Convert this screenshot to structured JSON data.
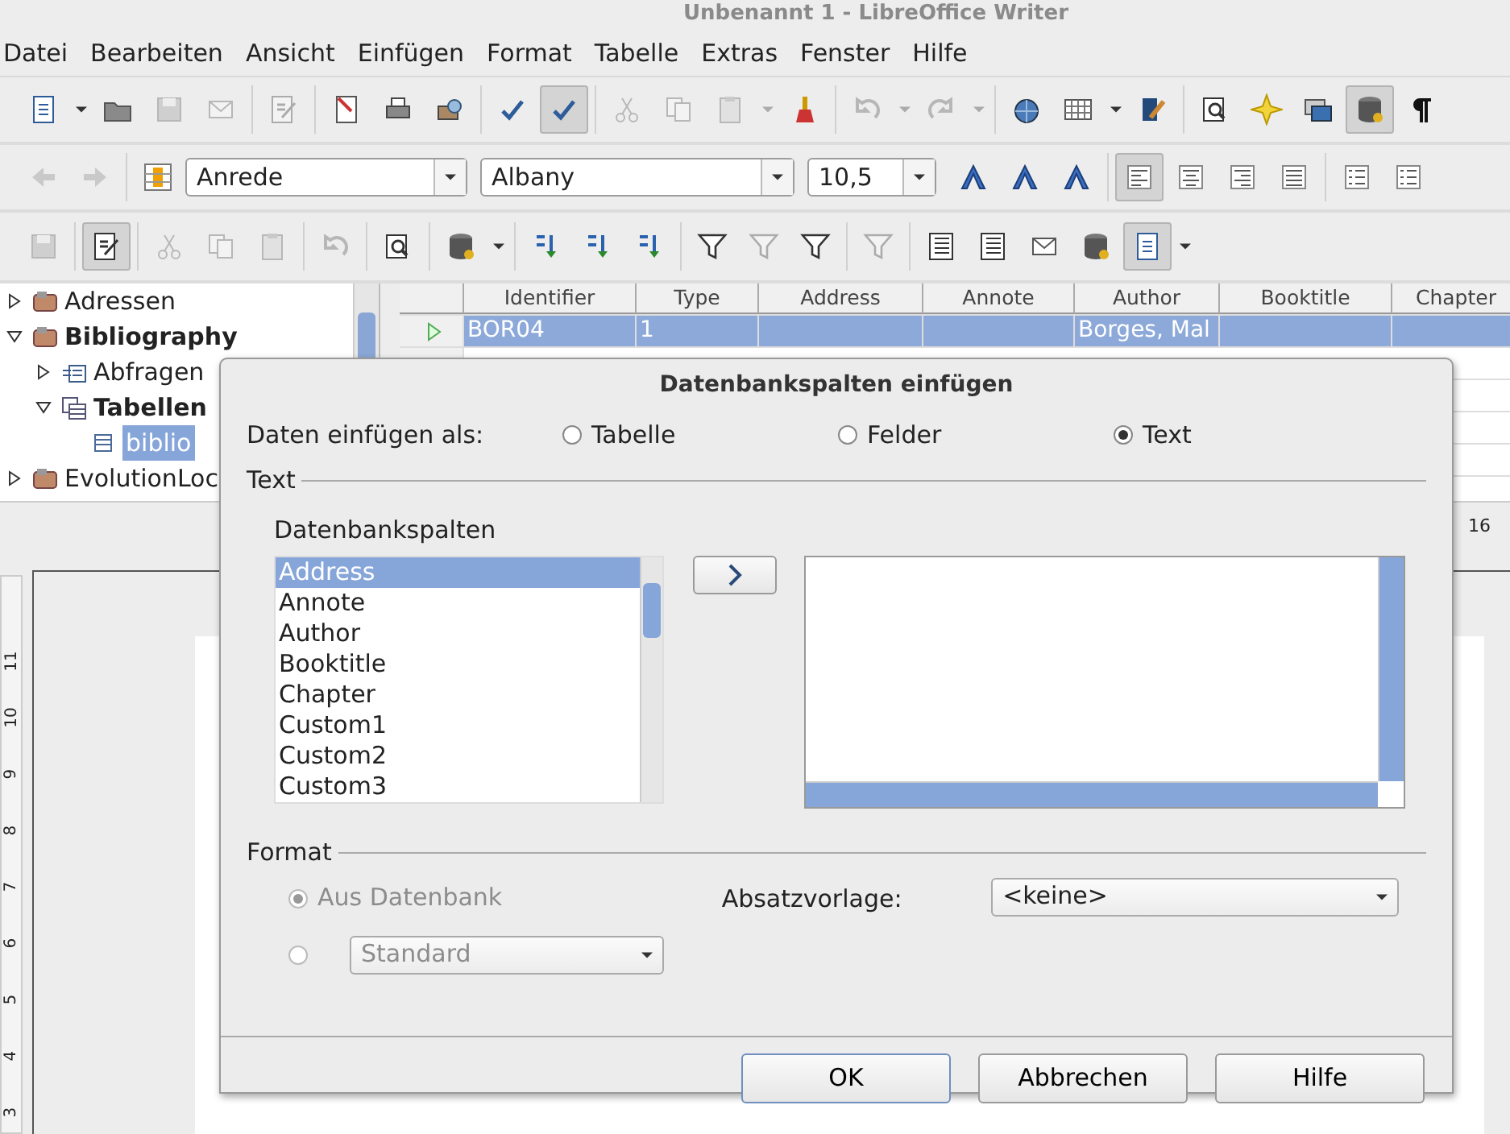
{
  "window": {
    "title": "Unbenannt 1 - LibreOffice Writer"
  },
  "menu": [
    "Datei",
    "Bearbeiten",
    "Ansicht",
    "Einfügen",
    "Format",
    "Tabelle",
    "Extras",
    "Fenster",
    "Hilfe"
  ],
  "toolbars": [
    [
      [
        {
          "kind": "document",
          "disabled": false,
          "pressed": false
        },
        {
          "kind": "caret",
          "disabled": false,
          "pressed": false
        },
        {
          "kind": "folder",
          "disabled": false,
          "pressed": false
        },
        {
          "kind": "floppy",
          "disabled": true,
          "pressed": false
        },
        {
          "kind": "envelope",
          "disabled": true,
          "pressed": false
        }
      ],
      [
        {
          "kind": "edit-document",
          "disabled": true,
          "pressed": false
        }
      ],
      [
        {
          "kind": "pdf-document",
          "disabled": false,
          "pressed": false
        },
        {
          "kind": "printer",
          "disabled": false,
          "pressed": false
        },
        {
          "kind": "print-preview",
          "disabled": false,
          "pressed": false
        }
      ],
      [
        {
          "kind": "check-mark",
          "disabled": false,
          "pressed": false
        },
        {
          "kind": "check-mark",
          "disabled": false,
          "pressed": true
        }
      ],
      [
        {
          "kind": "scissors",
          "disabled": true,
          "pressed": false
        },
        {
          "kind": "copy",
          "disabled": true,
          "pressed": false
        },
        {
          "kind": "clipboard",
          "disabled": true,
          "pressed": false
        },
        {
          "kind": "caret",
          "disabled": true,
          "pressed": false
        },
        {
          "kind": "paintbrush",
          "disabled": false,
          "pressed": false
        }
      ],
      [
        {
          "kind": "undo",
          "disabled": true,
          "pressed": false
        },
        {
          "kind": "caret",
          "disabled": true,
          "pressed": false
        },
        {
          "kind": "redo",
          "disabled": true,
          "pressed": false
        },
        {
          "kind": "caret",
          "disabled": true,
          "pressed": false
        }
      ],
      [
        {
          "kind": "globe",
          "disabled": false,
          "pressed": false
        },
        {
          "kind": "table",
          "disabled": false,
          "pressed": false
        },
        {
          "kind": "caret",
          "disabled": false,
          "pressed": false
        },
        {
          "kind": "pencil",
          "disabled": false,
          "pressed": false
        }
      ],
      [
        {
          "kind": "magnifier",
          "disabled": false,
          "pressed": false
        },
        {
          "kind": "star",
          "disabled": false,
          "pressed": false
        },
        {
          "kind": "monitor",
          "disabled": false,
          "pressed": false
        },
        {
          "kind": "database",
          "disabled": false,
          "pressed": true
        },
        {
          "kind": "pilcrow",
          "disabled": false,
          "pressed": false
        }
      ]
    ],
    [
      [
        {
          "kind": "arrow-left",
          "disabled": true,
          "pressed": false
        },
        {
          "kind": "arrow-right",
          "disabled": true,
          "pressed": false
        }
      ],
      [
        {
          "kind": "styles",
          "disabled": false,
          "pressed": false
        },
        {
          "kind": "combo",
          "value": "Anrede",
          "disabled": false
        },
        {
          "kind": "combo",
          "value": "Albany",
          "disabled": false
        },
        {
          "kind": "combo",
          "value": "10,5",
          "disabled": false
        },
        {
          "kind": "text-style",
          "disabled": false,
          "pressed": false
        },
        {
          "kind": "text-style",
          "disabled": false,
          "pressed": false
        },
        {
          "kind": "text-style",
          "disabled": false,
          "pressed": false
        }
      ],
      [
        {
          "kind": "align-left",
          "disabled": false,
          "pressed": true
        },
        {
          "kind": "align-center",
          "disabled": false,
          "pressed": false
        },
        {
          "kind": "align-right",
          "disabled": false,
          "pressed": false
        },
        {
          "kind": "align-justify",
          "disabled": false,
          "pressed": false
        }
      ],
      [
        {
          "kind": "list",
          "disabled": false,
          "pressed": false
        },
        {
          "kind": "list",
          "disabled": false,
          "pressed": false
        }
      ]
    ],
    [
      [
        {
          "kind": "floppy",
          "disabled": true,
          "pressed": false
        }
      ],
      [
        {
          "kind": "edit-document",
          "disabled": false,
          "pressed": true
        }
      ],
      [
        {
          "kind": "scissors",
          "disabled": true,
          "pressed": false
        },
        {
          "kind": "copy",
          "disabled": true,
          "pressed": false
        },
        {
          "kind": "clipboard",
          "disabled": true,
          "pressed": false
        }
      ],
      [
        {
          "kind": "undo",
          "disabled": true,
          "pressed": false
        }
      ],
      [
        {
          "kind": "magnifier",
          "disabled": false,
          "pressed": false
        }
      ],
      [
        {
          "kind": "database",
          "disabled": false,
          "pressed": false
        },
        {
          "kind": "caret",
          "disabled": false,
          "pressed": false
        }
      ],
      [
        {
          "kind": "sort",
          "disabled": false,
          "pressed": false
        },
        {
          "kind": "sort",
          "disabled": false,
          "pressed": false
        },
        {
          "kind": "sort",
          "disabled": false,
          "pressed": false
        }
      ],
      [
        {
          "kind": "filter",
          "disabled": false,
          "pressed": false
        },
        {
          "kind": "filter",
          "disabled": true,
          "pressed": false
        },
        {
          "kind": "filter",
          "disabled": false,
          "pressed": false
        }
      ],
      [
        {
          "kind": "filter",
          "disabled": true,
          "pressed": false
        }
      ],
      [
        {
          "kind": "text-lines",
          "disabled": false,
          "pressed": false
        },
        {
          "kind": "text-lines",
          "disabled": false,
          "pressed": false
        },
        {
          "kind": "envelope",
          "disabled": false,
          "pressed": false
        },
        {
          "kind": "database",
          "disabled": false,
          "pressed": false
        },
        {
          "kind": "document",
          "disabled": false,
          "pressed": true
        },
        {
          "kind": "caret",
          "disabled": false,
          "pressed": false
        }
      ]
    ]
  ],
  "data_sources": {
    "tree": [
      {
        "label": "Adressen",
        "kind": "database",
        "expanded": false,
        "selected": false
      },
      {
        "label": "Bibliography",
        "kind": "database",
        "expanded": true,
        "selected": false,
        "children": [
          {
            "label": "Abfragen",
            "kind": "queries",
            "expanded": false,
            "selected": false
          },
          {
            "label": "Tabellen",
            "kind": "tables",
            "expanded": true,
            "selected": false,
            "children": [
              {
                "label": "biblio",
                "kind": "table",
                "selected": true
              }
            ]
          }
        ]
      },
      {
        "label": "EvolutionLoc",
        "kind": "database",
        "expanded": false,
        "selected": false
      }
    ],
    "grid": {
      "columns": [
        "Identifier",
        "Type",
        "Address",
        "Annote",
        "Author",
        "Booktitle",
        "Chapter"
      ],
      "rows": [
        {
          "selected": true,
          "cells": [
            "BOR04",
            "1",
            null,
            null,
            "Borges, Mal",
            null,
            null
          ]
        }
      ]
    }
  },
  "ruler": {
    "horizontal": [
      "16"
    ],
    "vertical": [
      "11",
      "10",
      "9",
      "8",
      "7",
      "6",
      "5",
      "4",
      "3"
    ]
  },
  "dialog": {
    "title": "Datenbankspalten einfügen",
    "insert_as": {
      "label": "Daten einfügen als:",
      "options": [
        {
          "label": "Tabelle",
          "selected": false
        },
        {
          "label": "Felder",
          "selected": false
        },
        {
          "label": "Text",
          "selected": true
        }
      ]
    },
    "text_section": {
      "heading": "Text",
      "columns_label": "Datenbankspalten",
      "columns": [
        {
          "label": "Address",
          "selected": true
        },
        {
          "label": "Annote",
          "selected": false
        },
        {
          "label": "Author",
          "selected": false
        },
        {
          "label": "Booktitle",
          "selected": false
        },
        {
          "label": "Chapter",
          "selected": false
        },
        {
          "label": "Custom1",
          "selected": false
        },
        {
          "label": "Custom2",
          "selected": false
        },
        {
          "label": "Custom3",
          "selected": false
        }
      ]
    },
    "format_section": {
      "heading": "Format",
      "options": [
        {
          "label": "Aus Datenbank",
          "selected": true,
          "disabled": true
        },
        {
          "combo": "Standard",
          "selected": false,
          "disabled": true
        }
      ],
      "paragraph_style": {
        "label": "Absatzvorlage:",
        "value": "<keine>"
      }
    },
    "buttons": [
      {
        "label": "OK",
        "default": true
      },
      {
        "label": "Abbrechen",
        "default": false
      },
      {
        "label": "Hilfe",
        "default": false
      }
    ]
  }
}
